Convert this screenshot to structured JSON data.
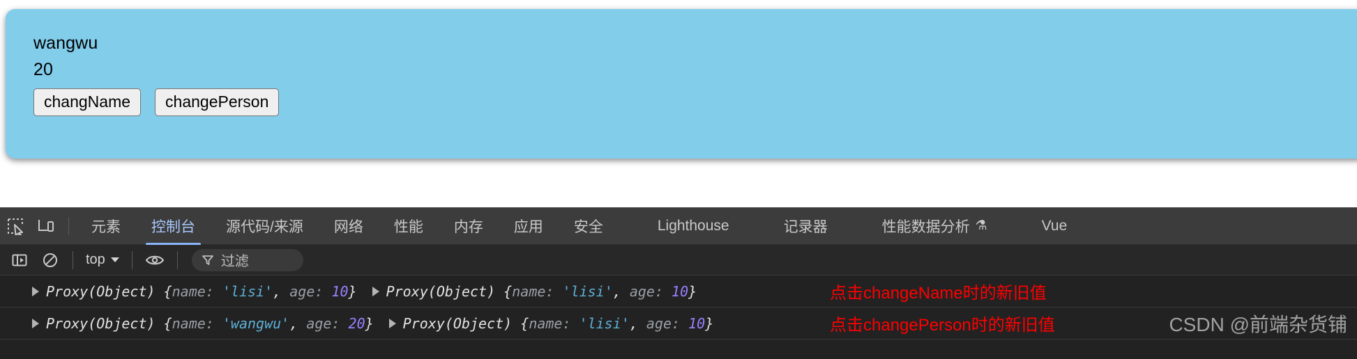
{
  "page": {
    "name_value": "wangwu",
    "age_value": "20",
    "buttons": [
      {
        "label": "changName",
        "name": "chang-name-button"
      },
      {
        "label": "changePerson",
        "name": "change-person-button"
      }
    ],
    "panel_color": "#82cdea"
  },
  "devtools": {
    "left_icons": [
      {
        "name": "inspect-element-icon",
        "title": "检查"
      },
      {
        "name": "device-toolbar-icon",
        "title": "切换设备工具栏"
      }
    ],
    "tabs": [
      {
        "label": "元素",
        "active": false
      },
      {
        "label": "控制台",
        "active": true
      },
      {
        "label": "源代码/来源",
        "active": false
      },
      {
        "label": "网络",
        "active": false
      },
      {
        "label": "性能",
        "active": false
      },
      {
        "label": "内存",
        "active": false
      },
      {
        "label": "应用",
        "active": false
      },
      {
        "label": "安全",
        "active": false
      },
      {
        "label": "Lighthouse",
        "active": false
      },
      {
        "label": "记录器",
        "active": false
      },
      {
        "label": "性能数据分析",
        "active": false,
        "flask": "⚗"
      },
      {
        "label": "Vue",
        "active": false
      }
    ],
    "active_tab_color": "#8ab4f8",
    "toolbar": {
      "sidebar_icon": "console-sidebar-icon",
      "clear_icon": "clear-console-icon",
      "context_value": "top",
      "eye_icon": "live-expression-icon",
      "filter_icon": "filter-icon",
      "filter_placeholder": "过滤"
    },
    "console": {
      "rows": [
        {
          "objects": [
            {
              "ctor": "Proxy(Object)",
              "name_key": "name: ",
              "name_val": "'lisi'",
              "sep": ", ",
              "age_key": "age: ",
              "age_val": "10"
            },
            {
              "ctor": "Proxy(Object)",
              "name_key": "name: ",
              "name_val": "'lisi'",
              "sep": ", ",
              "age_key": "age: ",
              "age_val": "10"
            }
          ],
          "annotation": "点击changeName时的新旧值",
          "annotation_color": "#ff0000"
        },
        {
          "objects": [
            {
              "ctor": "Proxy(Object)",
              "name_key": "name: ",
              "name_val": "'wangwu'",
              "sep": ", ",
              "age_key": "age: ",
              "age_val": "20"
            },
            {
              "ctor": "Proxy(Object)",
              "name_key": "name: ",
              "name_val": "'lisi'",
              "sep": ", ",
              "age_key": "age: ",
              "age_val": "10"
            }
          ],
          "annotation": "点击changePerson时的新旧值",
          "annotation_color": "#ff0000"
        }
      ]
    },
    "watermark": "CSDN @前端杂货铺"
  }
}
